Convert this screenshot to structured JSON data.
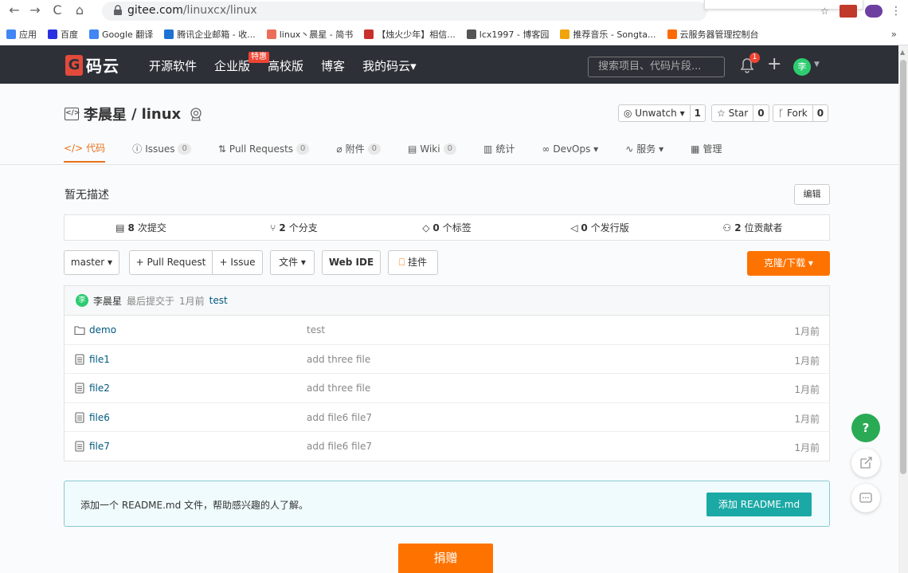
{
  "browser": {
    "url_domain": "gitee.com",
    "url_path": "/linuxcx/linux",
    "bookmarks": [
      {
        "label": "应用",
        "color": "#4285f4"
      },
      {
        "label": "百度",
        "color": "#2932e1"
      },
      {
        "label": "Google 翻译",
        "color": "#4285f4"
      },
      {
        "label": "腾讯企业邮箱 - 收...",
        "color": "#1e73d2"
      },
      {
        "label": "linux丶晨星 - 简书",
        "color": "#ea6f5a"
      },
      {
        "label": "【烛火少年】相信...",
        "color": "#c9302c"
      },
      {
        "label": "lcx1997 - 博客园",
        "color": "#555555"
      },
      {
        "label": "推荐音乐 - Songta...",
        "color": "#f0a30a"
      },
      {
        "label": "云服务器管理控制台",
        "color": "#ff6a00"
      }
    ],
    "more": "»"
  },
  "header": {
    "logo": "码云",
    "logo_g": "G",
    "nav": [
      "开源软件",
      "企业版",
      "高校版",
      "博客",
      "我的码云▾"
    ],
    "special_badge": "特惠",
    "search_placeholder": "搜索项目、代码片段...",
    "notification_count": "1",
    "avatar": "李"
  },
  "project": {
    "owner": "李晨星",
    "separator": " / ",
    "name": "linux",
    "watch": {
      "label": "◎ Unwatch ▾",
      "count": "1"
    },
    "star": {
      "label": "☆ Star",
      "count": "0"
    },
    "fork": {
      "label": "ᚴ Fork",
      "count": "0"
    },
    "tabs": [
      {
        "icon": "</>",
        "label": "代码",
        "count": null,
        "active": true
      },
      {
        "icon": "ⓘ",
        "label": "Issues",
        "count": "0"
      },
      {
        "icon": "⇅",
        "label": "Pull Requests",
        "count": "0"
      },
      {
        "icon": "⌀",
        "label": "附件",
        "count": "0"
      },
      {
        "icon": "▤",
        "label": "Wiki",
        "count": "0"
      },
      {
        "icon": "▥",
        "label": "统计",
        "count": null
      },
      {
        "icon": "∞",
        "label": "DevOps ▾",
        "count": null
      },
      {
        "icon": "∿",
        "label": "服务 ▾",
        "count": null
      },
      {
        "icon": "▦",
        "label": "管理",
        "count": null
      }
    ]
  },
  "main": {
    "description": "暂无描述",
    "edit_label": "编辑",
    "stats": [
      {
        "icon": "▤",
        "num": "8",
        "label": "次提交"
      },
      {
        "icon": "⑂",
        "num": "2",
        "label": "个分支"
      },
      {
        "icon": "◇",
        "num": "0",
        "label": "个标签"
      },
      {
        "icon": "◁",
        "num": "0",
        "label": "个发行版"
      },
      {
        "icon": "⚇",
        "num": "2",
        "label": "位贡献者"
      }
    ],
    "toolbar": {
      "branch": "master ▾",
      "pull_request": "+ Pull Request",
      "issue": "+ Issue",
      "files": "文件 ▾",
      "web_ide": "Web IDE",
      "widget": "挂件",
      "clone": "克隆/下载 ▾"
    },
    "last_commit": {
      "avatar": "李",
      "author": "李晨星",
      "text": "最后提交于",
      "time": "1月前",
      "message": "test"
    },
    "files": [
      {
        "type": "folder",
        "name": "demo",
        "message": "test",
        "time": "1月前"
      },
      {
        "type": "file",
        "name": "file1",
        "message": "add three file",
        "time": "1月前"
      },
      {
        "type": "file",
        "name": "file2",
        "message": "add three file",
        "time": "1月前"
      },
      {
        "type": "file",
        "name": "file6",
        "message": "add file6 file7",
        "time": "1月前"
      },
      {
        "type": "file",
        "name": "file7",
        "message": "add file6 file7",
        "time": "1月前"
      }
    ],
    "readme_hint": "添加一个 README.md 文件，帮助感兴趣的人了解。",
    "readme_button": "添加 README.md",
    "donate": "捐赠"
  },
  "floating": {
    "help": "?"
  },
  "colors": {
    "accent": "#fe7300",
    "header_bg": "#2d3037",
    "link": "#005980",
    "teal": "#1ba9a6"
  }
}
